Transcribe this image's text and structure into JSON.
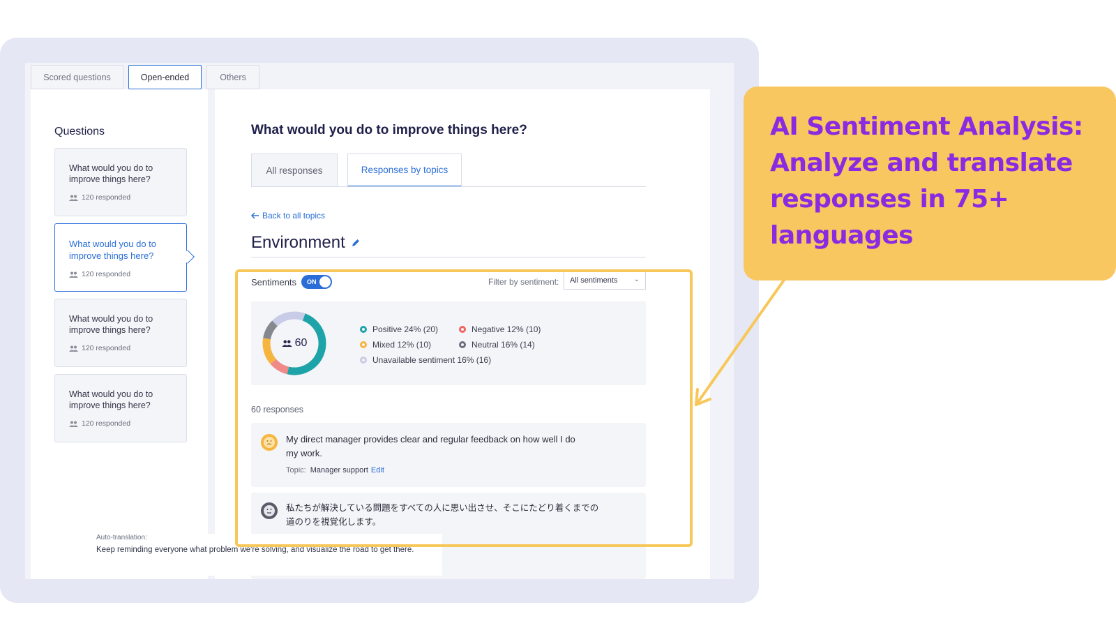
{
  "top_tabs": [
    {
      "label": "Scored questions"
    },
    {
      "label": "Open-ended"
    },
    {
      "label": "Others"
    }
  ],
  "sidebar": {
    "heading": "Questions",
    "items": [
      {
        "text": "What would you do to improve things here?",
        "count": "120 responded"
      },
      {
        "text": "What would you do to improve things here?",
        "count": "120 responded"
      },
      {
        "text": "What would you do to improve things here?",
        "count": "120 responded"
      },
      {
        "text": "What would you do to improve things here?",
        "count": "120 responded"
      }
    ]
  },
  "main": {
    "title": "What would you do to improve things here?",
    "tabs": [
      {
        "label": "All responses"
      },
      {
        "label": "Responses by topics"
      }
    ],
    "back_link": "Back to all topics",
    "topic_title": "Environment",
    "sentiments_label": "Sentiments",
    "toggle_label": "ON",
    "filter_label": "Filter by sentiment:",
    "filter_value": "All sentiments",
    "total_count": "60",
    "legend": [
      {
        "label": "Positive 24% (20)",
        "color": "#1ea3a8"
      },
      {
        "label": "Negative 12% (10)",
        "color": "#ef6461"
      },
      {
        "label": "Mixed 12% (10)",
        "color": "#f6b53f"
      },
      {
        "label": "Neutral 16% (14)",
        "color": "#6b6f7e"
      },
      {
        "label": "Unavailable sentiment 16% (16)",
        "color": "#c9cce6"
      }
    ],
    "donut_segments": [
      {
        "name": "Positive",
        "percent": 48,
        "color": "#1ea3a8"
      },
      {
        "name": "Negative",
        "percent": 10,
        "color": "#ef8a88"
      },
      {
        "name": "Mixed",
        "percent": 14,
        "color": "#f6b53f"
      },
      {
        "name": "Neutral",
        "percent": 10,
        "color": "#85888f"
      },
      {
        "name": "Unavailable",
        "percent": 18,
        "color": "#c9cce6"
      }
    ],
    "responses_count": "60 responses",
    "responses": [
      {
        "text_line1": "My direct manager provides clear and regular feedback on how well I do",
        "text_line2": "my work.",
        "topic_label": "Topic:",
        "topic_value": "Manager support",
        "edit_label": "Edit"
      },
      {
        "text_line1": "私たちが解決している問題をすべての人に思い出させ、そこにたどり着くまでの",
        "text_line2": "道のりを視覚化します。",
        "translation_label": "Auto-translation:",
        "translation_text": "Keep reminding everyone what problem we're solving, and visualize the road to get there."
      }
    ]
  },
  "callout": {
    "text": "AI Sentiment Analysis: Analyze and translate responses in 75+ languages",
    "color": "#8a2be2",
    "background": "#f9c760"
  }
}
